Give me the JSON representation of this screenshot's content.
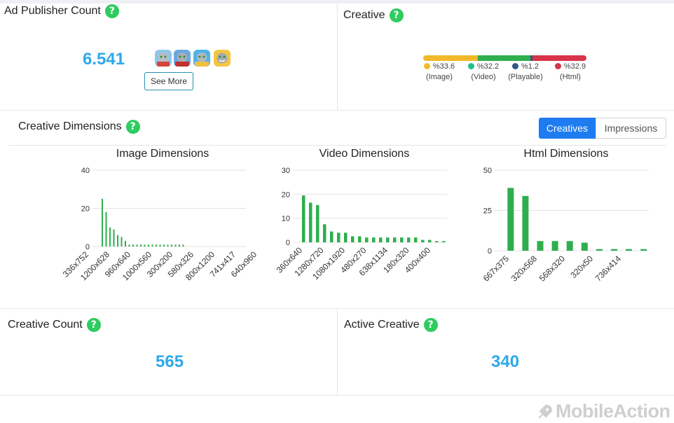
{
  "ad_publisher": {
    "title": "Ad Publisher Count",
    "count": "6.541",
    "see_more": "See More",
    "apps": [
      "app-icon",
      "app-icon",
      "app-icon",
      "app-icon"
    ]
  },
  "creative": {
    "title": "Creative",
    "segments": [
      {
        "percent": "%33.6",
        "label": "(Image)",
        "bar_color": "#f2b92a",
        "dot_color": "#f2b92a",
        "value": 33.6
      },
      {
        "percent": "%32.2",
        "label": "(Video)",
        "bar_color": "#2fae4e",
        "dot_color": "#21c08b",
        "value": 32.2
      },
      {
        "percent": "%1.2",
        "label": "(Playable)",
        "bar_color": "#2d5b86",
        "dot_color": "#2d5b86",
        "value": 1.2
      },
      {
        "percent": "%32.9",
        "label": "(Html)",
        "bar_color": "#d8344a",
        "dot_color": "#d8344a",
        "value": 32.9
      }
    ]
  },
  "dimensions": {
    "title": "Creative Dimensions",
    "tabs": [
      "Creatives",
      "Impressions"
    ],
    "active_tab": "Creatives"
  },
  "chart_data": [
    {
      "type": "bar",
      "title": "Image Dimensions",
      "ylim": [
        0,
        40
      ],
      "yticks": [
        "0",
        "20",
        "40"
      ],
      "categories": [
        "336x752",
        "1200x628",
        "960x640",
        "1000x560",
        "300x200",
        "580x326",
        "800x1200",
        "741x417",
        "640x960"
      ],
      "values": [
        25,
        18,
        10,
        9,
        6,
        5,
        3,
        1,
        1,
        1,
        1,
        1,
        1,
        1,
        1,
        1,
        1,
        1,
        1,
        1,
        1,
        1
      ],
      "bar_labels_shown": [
        "336x752",
        "",
        "1200x628",
        "",
        "960x640",
        "",
        "1000x560",
        "",
        "300x200",
        "",
        "580x326",
        "",
        "800x1200",
        "",
        "741x417",
        "",
        "640x960"
      ],
      "color": "#2fae4e"
    },
    {
      "type": "bar",
      "title": "Video Dimensions",
      "ylim": [
        0,
        30
      ],
      "yticks": [
        "0",
        "10",
        "20",
        "30"
      ],
      "categories": [
        "360x640",
        "1280x720",
        "1080x1920",
        "480x270",
        "638x1134",
        "180x320",
        "400x400"
      ],
      "values": [
        19.5,
        16.5,
        15.5,
        7.5,
        4.5,
        4,
        4,
        2.5,
        2.5,
        2,
        2,
        2,
        2,
        2,
        2,
        2,
        2,
        1,
        1,
        0.5,
        0.5
      ],
      "color": "#2fae4e"
    },
    {
      "type": "bar",
      "title": "Html Dimensions",
      "ylim": [
        0,
        50
      ],
      "yticks": [
        "0",
        "25",
        "50"
      ],
      "categories": [
        "667x375",
        "320x568",
        "568x320",
        "320x50",
        "736x414"
      ],
      "values": [
        39,
        34,
        6,
        6,
        6,
        5,
        1,
        1,
        1,
        1
      ],
      "color": "#2fae4e"
    }
  ],
  "creative_count": {
    "title": "Creative Count",
    "value": "565"
  },
  "active_creative": {
    "title": "Active Creative",
    "value": "340"
  },
  "brand": {
    "name": "MobileAction"
  }
}
